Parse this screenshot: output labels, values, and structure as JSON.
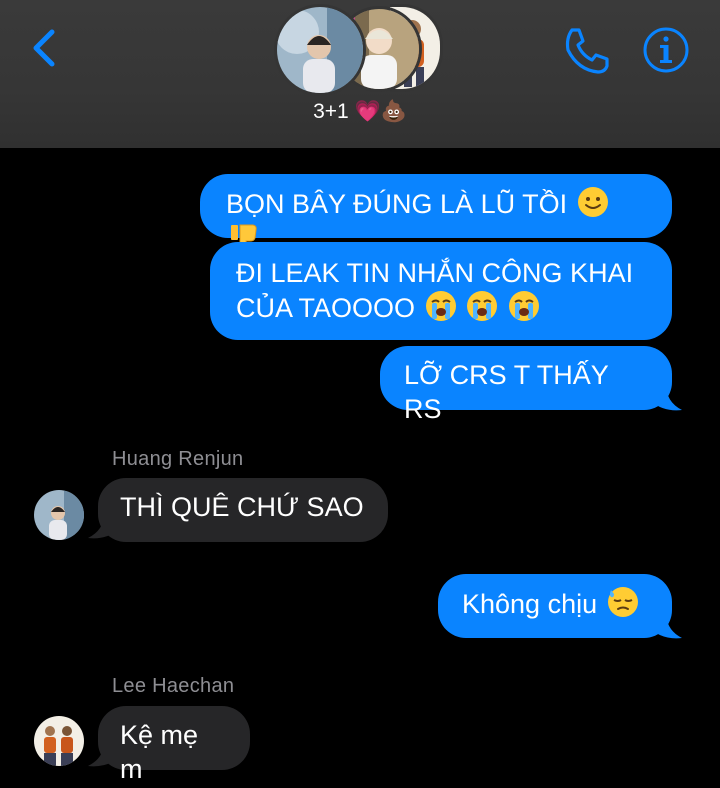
{
  "header": {
    "group_name": "3+1 💗💩",
    "back_icon": "chevron-left-icon",
    "call_icon": "phone-icon",
    "info_icon": "info-icon",
    "accent": "#0a84ff"
  },
  "messages": [
    {
      "direction": "out",
      "text": "BỌN BÂY ĐÚNG LÀ LŨ TỒI",
      "emojis": [
        "slightly-smiling-face-icon",
        "thumbs-down-icon"
      ]
    },
    {
      "direction": "out",
      "line1": "ĐI LEAK TIN NHẮN CÔNG KHAI",
      "line2": "CỦA TAOOOO",
      "emojis": [
        "crying-face-icon",
        "crying-face-icon",
        "crying-face-icon"
      ]
    },
    {
      "direction": "out",
      "text": "LỠ CRS T THẤY RS"
    },
    {
      "direction": "in",
      "sender": "Huang Renjun",
      "text": "THÌ QUÊ CHỨ SAO"
    },
    {
      "direction": "out",
      "text": "Không chịu",
      "emojis": [
        "downcast-sweat-face-icon"
      ]
    },
    {
      "direction": "in",
      "sender": "Lee Haechan",
      "text": "Kệ mẹ m"
    }
  ],
  "colors": {
    "outgoing": "#0a84ff",
    "incoming": "#262628",
    "background": "#000000"
  }
}
